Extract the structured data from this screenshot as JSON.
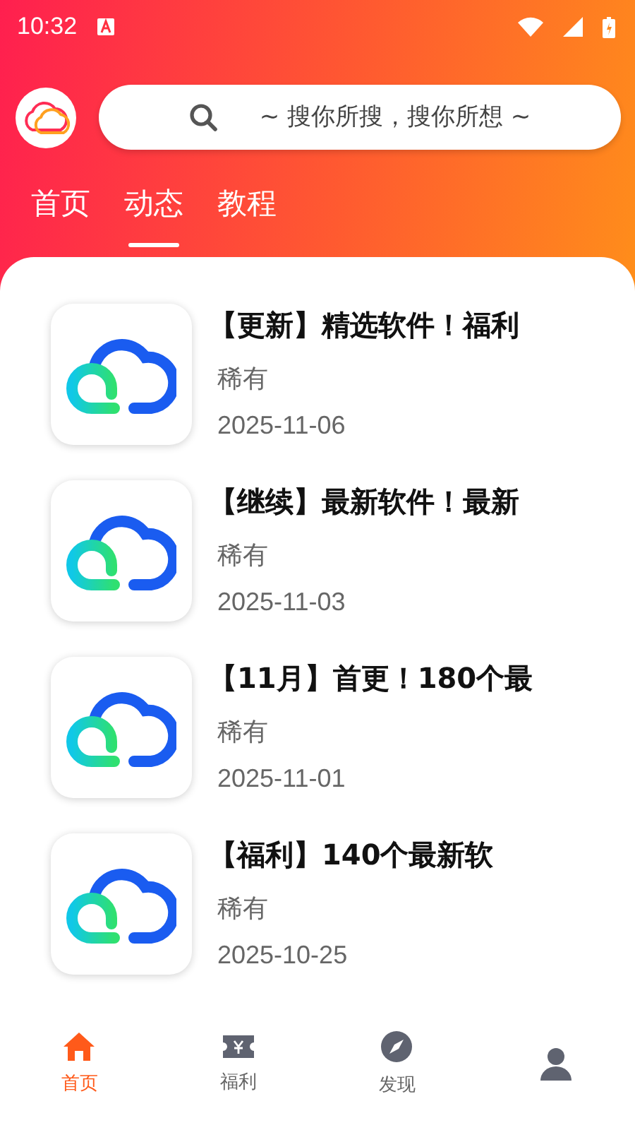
{
  "status_bar": {
    "time": "10:32"
  },
  "search": {
    "placeholder": "~ 搜你所搜，搜你所想 ~"
  },
  "tabs": [
    {
      "label": "首页",
      "selected": false
    },
    {
      "label": "动态",
      "selected": true
    },
    {
      "label": "教程",
      "selected": false
    }
  ],
  "posts": [
    {
      "title": "【更新】精选软件！福利",
      "author": "稀有",
      "date": "2025-11-06"
    },
    {
      "title": "【继续】最新软件！最新",
      "author": "稀有",
      "date": "2025-11-03"
    },
    {
      "title": "【11月】首更！180个最",
      "author": "稀有",
      "date": "2025-11-01"
    },
    {
      "title": "【福利】140个最新软",
      "author": "稀有",
      "date": "2025-10-25"
    }
  ],
  "nav": [
    {
      "kind": "home",
      "label": "首页",
      "selected": true
    },
    {
      "kind": "ticket",
      "label": "福利",
      "selected": false
    },
    {
      "kind": "compass",
      "label": "发现",
      "selected": false
    },
    {
      "kind": "user",
      "selected": false
    }
  ]
}
